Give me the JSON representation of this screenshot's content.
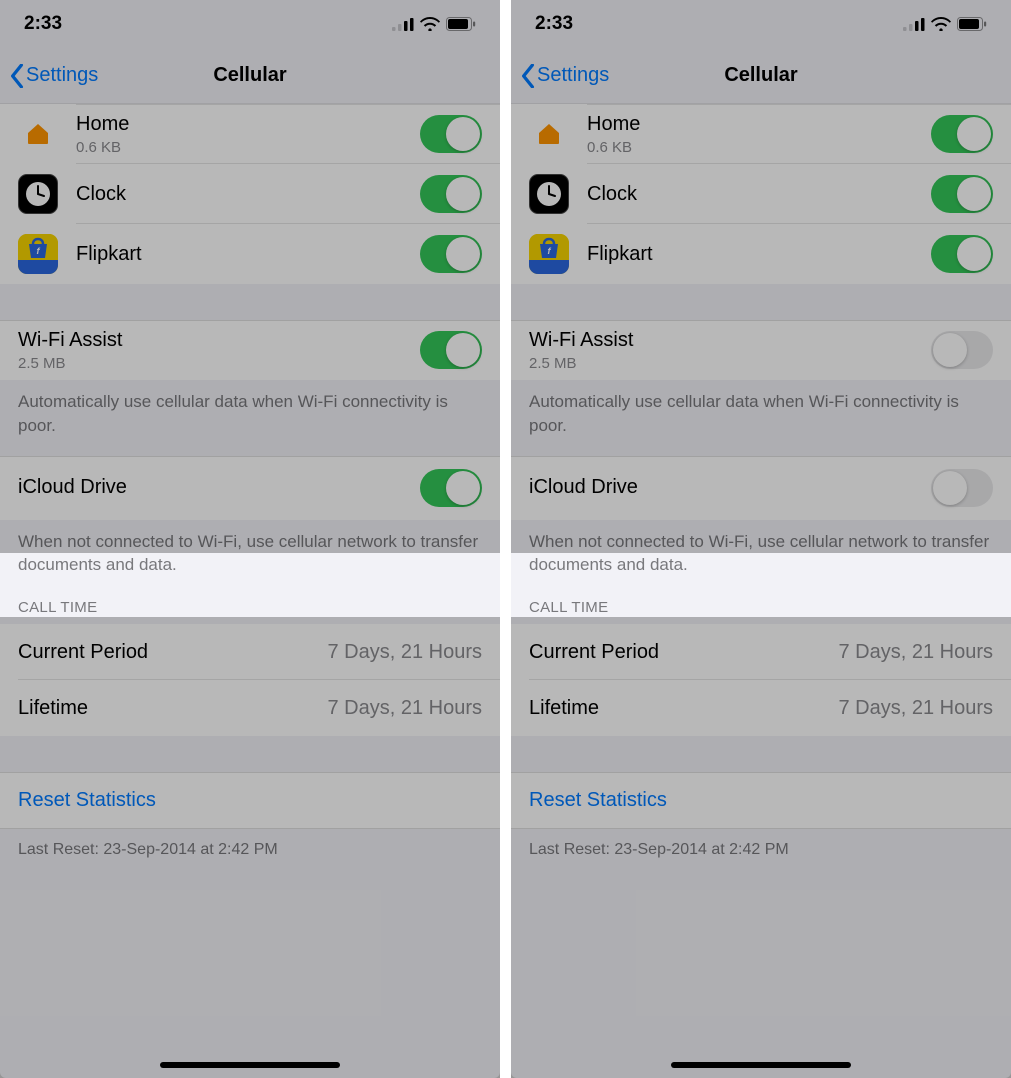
{
  "status": {
    "time": "2:33"
  },
  "nav": {
    "back": "Settings",
    "title": "Cellular"
  },
  "apps": [
    {
      "name": "Home",
      "sub": "0.6 KB",
      "on": true,
      "icon": "home"
    },
    {
      "name": "Clock",
      "sub": "",
      "on": true,
      "icon": "clock"
    },
    {
      "name": "Flipkart",
      "sub": "",
      "on": true,
      "icon": "flipkart"
    }
  ],
  "wifiAssist": {
    "title": "Wi-Fi Assist",
    "sub": "2.5 MB",
    "footer": "Automatically use cellular data when Wi-Fi connectivity is poor.",
    "left_on": true,
    "right_on": false
  },
  "icloud": {
    "title": "iCloud Drive",
    "footer": "When not connected to Wi-Fi, use cellular network to transfer documents and data.",
    "left_on": true,
    "right_on": false
  },
  "callTime": {
    "header": "CALL TIME",
    "rows": [
      {
        "k": "Current Period",
        "v": "7 Days, 21 Hours"
      },
      {
        "k": "Lifetime",
        "v": "7 Days, 21 Hours"
      }
    ]
  },
  "reset": {
    "label": "Reset Statistics",
    "last": "Last Reset: 23-Sep-2014 at 2:42 PM"
  }
}
